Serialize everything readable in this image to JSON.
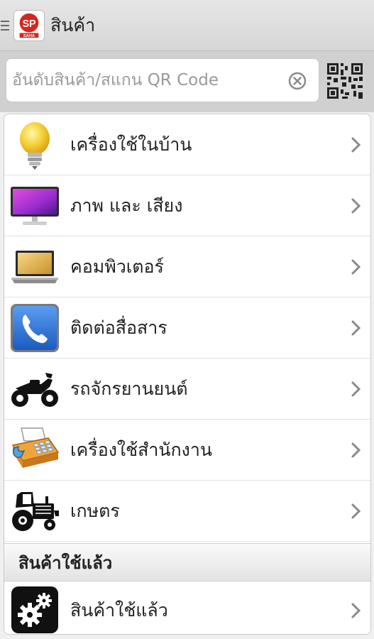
{
  "appbar": {
    "title": "สินค้า",
    "logo_text": "SP",
    "logo_subtext": "SAHA"
  },
  "search": {
    "placeholder": "อันดับสินค้า/สแกน QR Code"
  },
  "categories": [
    {
      "label": "เครื่องใช้ในบ้าน",
      "icon": "lightbulb-icon"
    },
    {
      "label": "ภาพ และ เสียง",
      "icon": "monitor-icon"
    },
    {
      "label": "คอมพิวเตอร์",
      "icon": "laptop-icon"
    },
    {
      "label": "ติดต่อสื่อสาร",
      "icon": "phone-icon"
    },
    {
      "label": "รถจักรยานยนต์",
      "icon": "motorcycle-icon"
    },
    {
      "label": "เครื่องใช้สำนักงาน",
      "icon": "fax-machine-icon"
    },
    {
      "label": "เกษตร",
      "icon": "tractor-icon"
    }
  ],
  "used_section": {
    "title": "สินค้าใช้แล้ว",
    "items": [
      {
        "label": "สินค้าใช้แล้ว",
        "icon": "gears-icon"
      }
    ]
  },
  "colors": {
    "brand_red": "#d7261e",
    "appbar_bg": "#dddddd",
    "searchbar_bg": "#d0d0d0"
  }
}
